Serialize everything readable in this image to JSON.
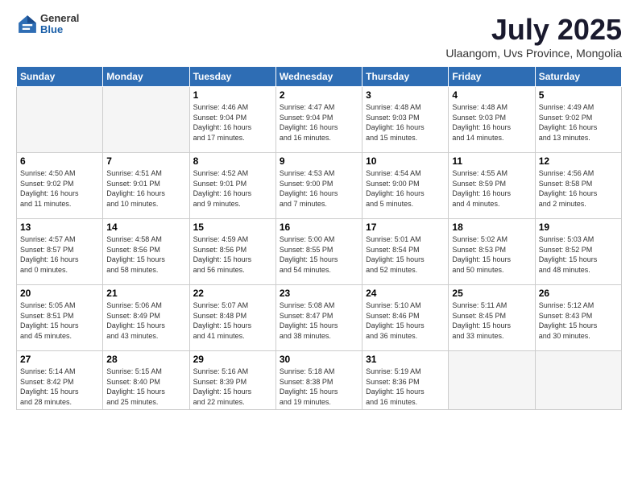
{
  "header": {
    "logo_general": "General",
    "logo_blue": "Blue",
    "title": "July 2025",
    "subtitle": "Ulaangom, Uvs Province, Mongolia"
  },
  "days_of_week": [
    "Sunday",
    "Monday",
    "Tuesday",
    "Wednesday",
    "Thursday",
    "Friday",
    "Saturday"
  ],
  "weeks": [
    [
      {
        "day": "",
        "info": ""
      },
      {
        "day": "",
        "info": ""
      },
      {
        "day": "1",
        "info": "Sunrise: 4:46 AM\nSunset: 9:04 PM\nDaylight: 16 hours\nand 17 minutes."
      },
      {
        "day": "2",
        "info": "Sunrise: 4:47 AM\nSunset: 9:04 PM\nDaylight: 16 hours\nand 16 minutes."
      },
      {
        "day": "3",
        "info": "Sunrise: 4:48 AM\nSunset: 9:03 PM\nDaylight: 16 hours\nand 15 minutes."
      },
      {
        "day": "4",
        "info": "Sunrise: 4:48 AM\nSunset: 9:03 PM\nDaylight: 16 hours\nand 14 minutes."
      },
      {
        "day": "5",
        "info": "Sunrise: 4:49 AM\nSunset: 9:02 PM\nDaylight: 16 hours\nand 13 minutes."
      }
    ],
    [
      {
        "day": "6",
        "info": "Sunrise: 4:50 AM\nSunset: 9:02 PM\nDaylight: 16 hours\nand 11 minutes."
      },
      {
        "day": "7",
        "info": "Sunrise: 4:51 AM\nSunset: 9:01 PM\nDaylight: 16 hours\nand 10 minutes."
      },
      {
        "day": "8",
        "info": "Sunrise: 4:52 AM\nSunset: 9:01 PM\nDaylight: 16 hours\nand 9 minutes."
      },
      {
        "day": "9",
        "info": "Sunrise: 4:53 AM\nSunset: 9:00 PM\nDaylight: 16 hours\nand 7 minutes."
      },
      {
        "day": "10",
        "info": "Sunrise: 4:54 AM\nSunset: 9:00 PM\nDaylight: 16 hours\nand 5 minutes."
      },
      {
        "day": "11",
        "info": "Sunrise: 4:55 AM\nSunset: 8:59 PM\nDaylight: 16 hours\nand 4 minutes."
      },
      {
        "day": "12",
        "info": "Sunrise: 4:56 AM\nSunset: 8:58 PM\nDaylight: 16 hours\nand 2 minutes."
      }
    ],
    [
      {
        "day": "13",
        "info": "Sunrise: 4:57 AM\nSunset: 8:57 PM\nDaylight: 16 hours\nand 0 minutes."
      },
      {
        "day": "14",
        "info": "Sunrise: 4:58 AM\nSunset: 8:56 PM\nDaylight: 15 hours\nand 58 minutes."
      },
      {
        "day": "15",
        "info": "Sunrise: 4:59 AM\nSunset: 8:56 PM\nDaylight: 15 hours\nand 56 minutes."
      },
      {
        "day": "16",
        "info": "Sunrise: 5:00 AM\nSunset: 8:55 PM\nDaylight: 15 hours\nand 54 minutes."
      },
      {
        "day": "17",
        "info": "Sunrise: 5:01 AM\nSunset: 8:54 PM\nDaylight: 15 hours\nand 52 minutes."
      },
      {
        "day": "18",
        "info": "Sunrise: 5:02 AM\nSunset: 8:53 PM\nDaylight: 15 hours\nand 50 minutes."
      },
      {
        "day": "19",
        "info": "Sunrise: 5:03 AM\nSunset: 8:52 PM\nDaylight: 15 hours\nand 48 minutes."
      }
    ],
    [
      {
        "day": "20",
        "info": "Sunrise: 5:05 AM\nSunset: 8:51 PM\nDaylight: 15 hours\nand 45 minutes."
      },
      {
        "day": "21",
        "info": "Sunrise: 5:06 AM\nSunset: 8:49 PM\nDaylight: 15 hours\nand 43 minutes."
      },
      {
        "day": "22",
        "info": "Sunrise: 5:07 AM\nSunset: 8:48 PM\nDaylight: 15 hours\nand 41 minutes."
      },
      {
        "day": "23",
        "info": "Sunrise: 5:08 AM\nSunset: 8:47 PM\nDaylight: 15 hours\nand 38 minutes."
      },
      {
        "day": "24",
        "info": "Sunrise: 5:10 AM\nSunset: 8:46 PM\nDaylight: 15 hours\nand 36 minutes."
      },
      {
        "day": "25",
        "info": "Sunrise: 5:11 AM\nSunset: 8:45 PM\nDaylight: 15 hours\nand 33 minutes."
      },
      {
        "day": "26",
        "info": "Sunrise: 5:12 AM\nSunset: 8:43 PM\nDaylight: 15 hours\nand 30 minutes."
      }
    ],
    [
      {
        "day": "27",
        "info": "Sunrise: 5:14 AM\nSunset: 8:42 PM\nDaylight: 15 hours\nand 28 minutes."
      },
      {
        "day": "28",
        "info": "Sunrise: 5:15 AM\nSunset: 8:40 PM\nDaylight: 15 hours\nand 25 minutes."
      },
      {
        "day": "29",
        "info": "Sunrise: 5:16 AM\nSunset: 8:39 PM\nDaylight: 15 hours\nand 22 minutes."
      },
      {
        "day": "30",
        "info": "Sunrise: 5:18 AM\nSunset: 8:38 PM\nDaylight: 15 hours\nand 19 minutes."
      },
      {
        "day": "31",
        "info": "Sunrise: 5:19 AM\nSunset: 8:36 PM\nDaylight: 15 hours\nand 16 minutes."
      },
      {
        "day": "",
        "info": ""
      },
      {
        "day": "",
        "info": ""
      }
    ]
  ]
}
